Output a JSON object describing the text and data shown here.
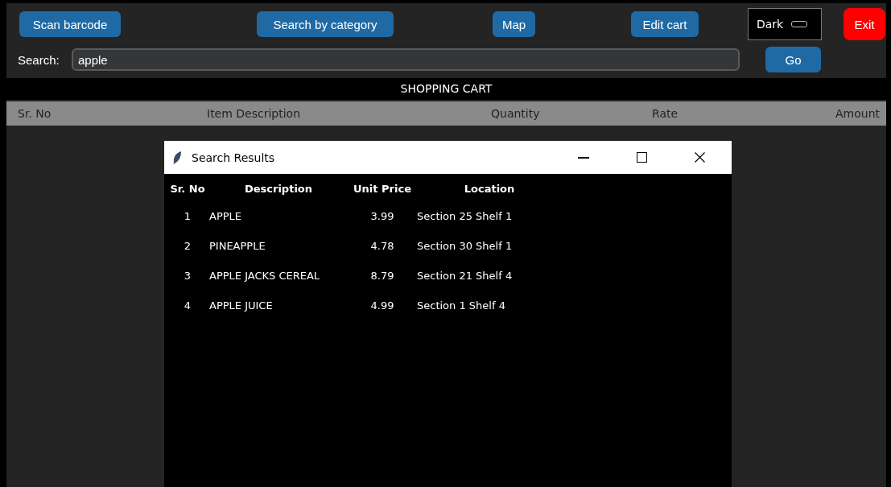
{
  "toolbar": {
    "buttons": [
      {
        "label": "Scan barcode"
      },
      {
        "label": "Search by category"
      },
      {
        "label": "Map"
      },
      {
        "label": "Edit cart"
      }
    ],
    "theme_switch": {
      "label": "Dark",
      "on": false
    },
    "exit_button": "Exit"
  },
  "search": {
    "label": "Search:",
    "value": "apple",
    "button": "Go"
  },
  "cart": {
    "title": "SHOPPING CART",
    "columns": [
      "Sr. No",
      "Item Description",
      "Quantity",
      "Rate",
      "Amount"
    ]
  },
  "dialog": {
    "title": "Search Results",
    "columns": [
      "Sr. No",
      "Description",
      "Unit Price",
      "Location"
    ],
    "rows": [
      {
        "sr": "1",
        "description": "APPLE",
        "price": "3.99",
        "location": "Section 25 Shelf 1"
      },
      {
        "sr": "2",
        "description": "PINEAPPLE",
        "price": "4.78",
        "location": "Section 30 Shelf 1"
      },
      {
        "sr": "3",
        "description": "APPLE JACKS CEREAL",
        "price": "8.79",
        "location": "Section 21 Shelf 4"
      },
      {
        "sr": "4",
        "description": "APPLE JUICE",
        "price": "4.99",
        "location": "Section 1 Shelf 4"
      }
    ]
  }
}
